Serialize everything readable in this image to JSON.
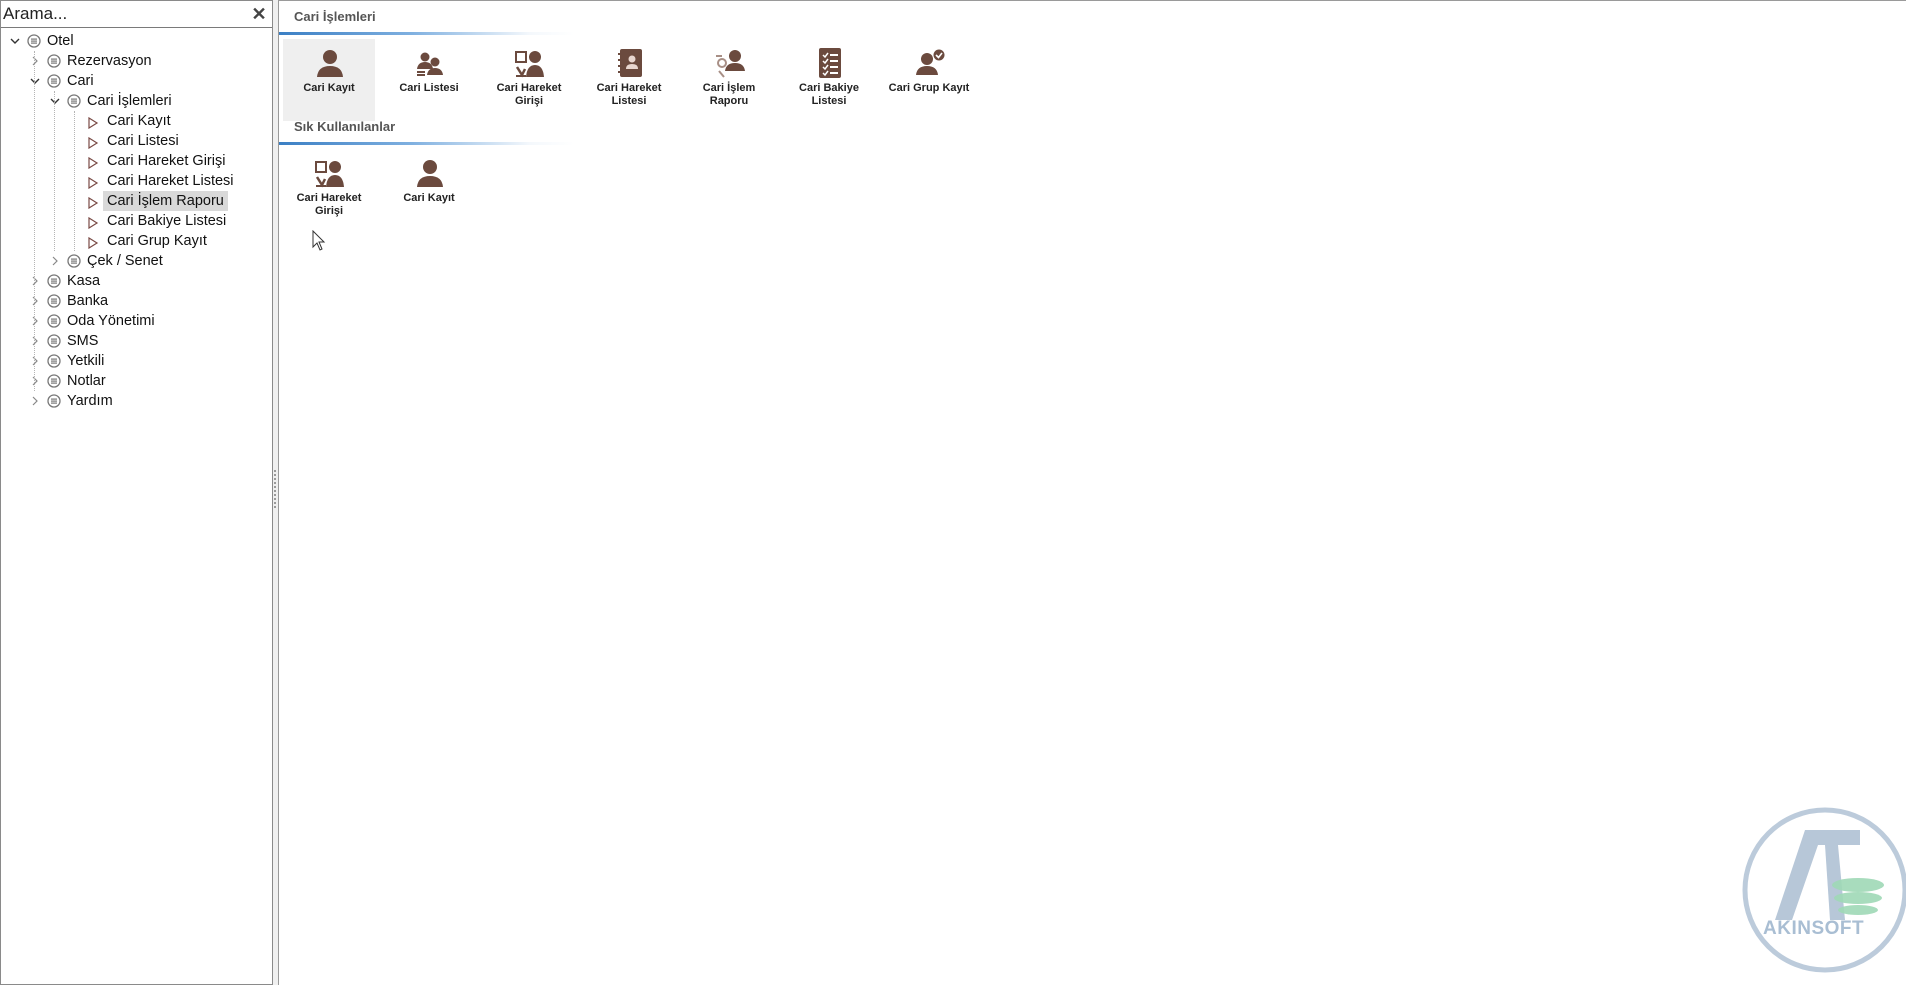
{
  "search": {
    "placeholder": "Arama...",
    "close_glyph": "✕"
  },
  "tree": {
    "items": [
      {
        "label": "Otel",
        "level": 0,
        "expanded": true,
        "type": "node"
      },
      {
        "label": "Rezervasyon",
        "level": 1,
        "expanded": false,
        "type": "node"
      },
      {
        "label": "Cari",
        "level": 1,
        "expanded": true,
        "type": "node"
      },
      {
        "label": "Cari İşlemleri",
        "level": 2,
        "expanded": true,
        "type": "node"
      },
      {
        "label": "Cari Kayıt",
        "level": 3,
        "type": "leaf"
      },
      {
        "label": "Cari Listesi",
        "level": 3,
        "type": "leaf"
      },
      {
        "label": "Cari Hareket Girişi",
        "level": 3,
        "type": "leaf"
      },
      {
        "label": "Cari Hareket Listesi",
        "level": 3,
        "type": "leaf"
      },
      {
        "label": "Cari İşlem Raporu",
        "level": 3,
        "type": "leaf",
        "selected": true
      },
      {
        "label": "Cari Bakiye Listesi",
        "level": 3,
        "type": "leaf"
      },
      {
        "label": "Cari Grup Kayıt",
        "level": 3,
        "type": "leaf"
      },
      {
        "label": "Çek / Senet",
        "level": 2,
        "expanded": false,
        "type": "node"
      },
      {
        "label": "Kasa",
        "level": 1,
        "expanded": false,
        "type": "node"
      },
      {
        "label": "Banka",
        "level": 1,
        "expanded": false,
        "type": "node"
      },
      {
        "label": "Oda Yönetimi",
        "level": 1,
        "expanded": false,
        "type": "node"
      },
      {
        "label": "SMS",
        "level": 1,
        "expanded": false,
        "type": "node"
      },
      {
        "label": "Yetkili",
        "level": 1,
        "expanded": false,
        "type": "node"
      },
      {
        "label": "Notlar",
        "level": 1,
        "expanded": false,
        "type": "node"
      },
      {
        "label": "Yardım",
        "level": 1,
        "expanded": false,
        "type": "node"
      }
    ]
  },
  "sections": [
    {
      "title": "Cari İşlemleri",
      "tiles": [
        {
          "label": "Cari Kayıt",
          "icon": "person-icon",
          "hover": true
        },
        {
          "label": "Cari Listesi",
          "icon": "people-list-icon"
        },
        {
          "label": "Cari Hareket Girişi",
          "icon": "transaction-entry-icon"
        },
        {
          "label": "Cari Hareket Listesi",
          "icon": "ledger-book-icon"
        },
        {
          "label": "Cari İşlem Raporu",
          "icon": "person-report-icon"
        },
        {
          "label": "Cari Bakiye Listesi",
          "icon": "checklist-icon"
        },
        {
          "label": "Cari Grup Kayıt",
          "icon": "person-check-icon"
        }
      ]
    },
    {
      "title": "Sık Kullanılanlar",
      "tiles": [
        {
          "label": "Cari Hareket Girişi",
          "icon": "transaction-entry-icon"
        },
        {
          "label": "Cari Kayıt",
          "icon": "person-icon"
        }
      ]
    }
  ],
  "watermark": {
    "text": "AKINSOFT"
  },
  "colors": {
    "icon": "#6b4a3e",
    "accent": "#3b7fc4",
    "watermark": "#a9bed3",
    "selected": "#d9d9d9"
  }
}
